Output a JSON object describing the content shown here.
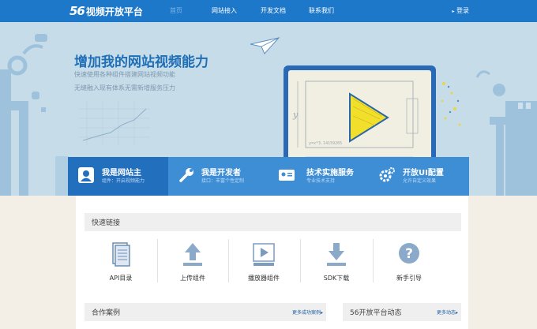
{
  "header": {
    "logo_mark": "56",
    "logo_text": "视频开放平台",
    "nav": [
      "首页",
      "网站接入",
      "开发文档",
      "联系我们"
    ],
    "login": "登录"
  },
  "hero": {
    "title": "增加我的网站视频能力",
    "lines": [
      "快速使用各种组件搭建网站视频功能",
      "无缝融入现有体系无需新增服务压力"
    ],
    "board_y": "y",
    "board_x": "x",
    "board_formula": "y=x*3.14159265"
  },
  "tabs": [
    {
      "title": "我是网站主",
      "sub": "组件：开启视频能力"
    },
    {
      "title": "我是开发者",
      "sub": "接口：丰富个性定制"
    },
    {
      "title": "技术实施服务",
      "sub": "专业技术支持"
    },
    {
      "title": "开放UI配置",
      "sub": "允许自定义效果"
    }
  ],
  "quick": {
    "heading": "快速链接",
    "items": [
      "API目录",
      "上传组件",
      "播放器组件",
      "SDK下载",
      "新手引导"
    ]
  },
  "cases": {
    "heading": "合作案例",
    "more": "更多成功案例▸"
  },
  "news": {
    "heading": "56开放平台动态",
    "more": "更多动态▸"
  },
  "colors": {
    "primary": "#1d78c9",
    "tab": "#3e8ed6",
    "tab_active": "#226fbe",
    "hero_bg": "#c6dce9",
    "page_bg": "#f3efe6"
  }
}
